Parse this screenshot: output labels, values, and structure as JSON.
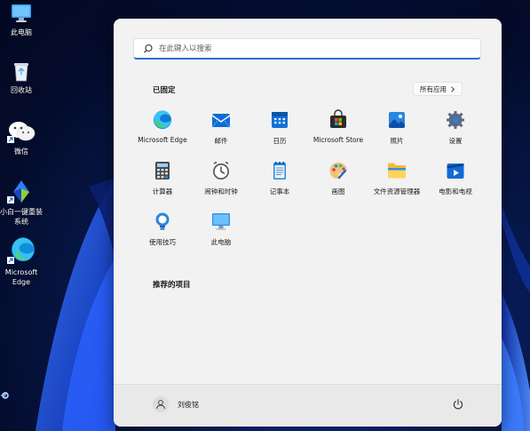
{
  "desktop": {
    "icons": [
      {
        "label": "此电脑",
        "icon": "computer-icon"
      },
      {
        "label": "回收站",
        "icon": "recycle-bin-icon"
      },
      {
        "label": "微信",
        "icon": "wechat-icon"
      },
      {
        "label": "小白一键重装系统",
        "icon": "xiaobai-installer-icon"
      },
      {
        "label": "Microsoft Edge",
        "icon": "edge-icon"
      }
    ]
  },
  "start_menu": {
    "search": {
      "placeholder": "在此键入以搜索",
      "value": ""
    },
    "pinned": {
      "title": "已固定",
      "all_apps_label": "所有应用",
      "apps": [
        {
          "label": "Microsoft Edge",
          "icon": "edge-icon"
        },
        {
          "label": "邮件",
          "icon": "mail-icon"
        },
        {
          "label": "日历",
          "icon": "calendar-icon"
        },
        {
          "label": "Microsoft Store",
          "icon": "store-icon"
        },
        {
          "label": "照片",
          "icon": "photos-icon"
        },
        {
          "label": "设置",
          "icon": "settings-icon"
        },
        {
          "label": "计算器",
          "icon": "calculator-icon"
        },
        {
          "label": "闹钟和时钟",
          "icon": "clock-icon"
        },
        {
          "label": "记事本",
          "icon": "notepad-icon"
        },
        {
          "label": "画图",
          "icon": "paint-icon"
        },
        {
          "label": "文件资源管理器",
          "icon": "file-explorer-icon"
        },
        {
          "label": "电影和电视",
          "icon": "movies-tv-icon"
        },
        {
          "label": "使用技巧",
          "icon": "tips-icon"
        },
        {
          "label": "此电脑",
          "icon": "computer-icon"
        }
      ]
    },
    "recommended": {
      "title": "推荐的项目"
    },
    "user": {
      "name": "刘俊铭"
    }
  },
  "colors": {
    "accent": "#1f6fd1",
    "menu_bg": "#f2f2f2",
    "footer_bg": "#e9e9e9"
  }
}
